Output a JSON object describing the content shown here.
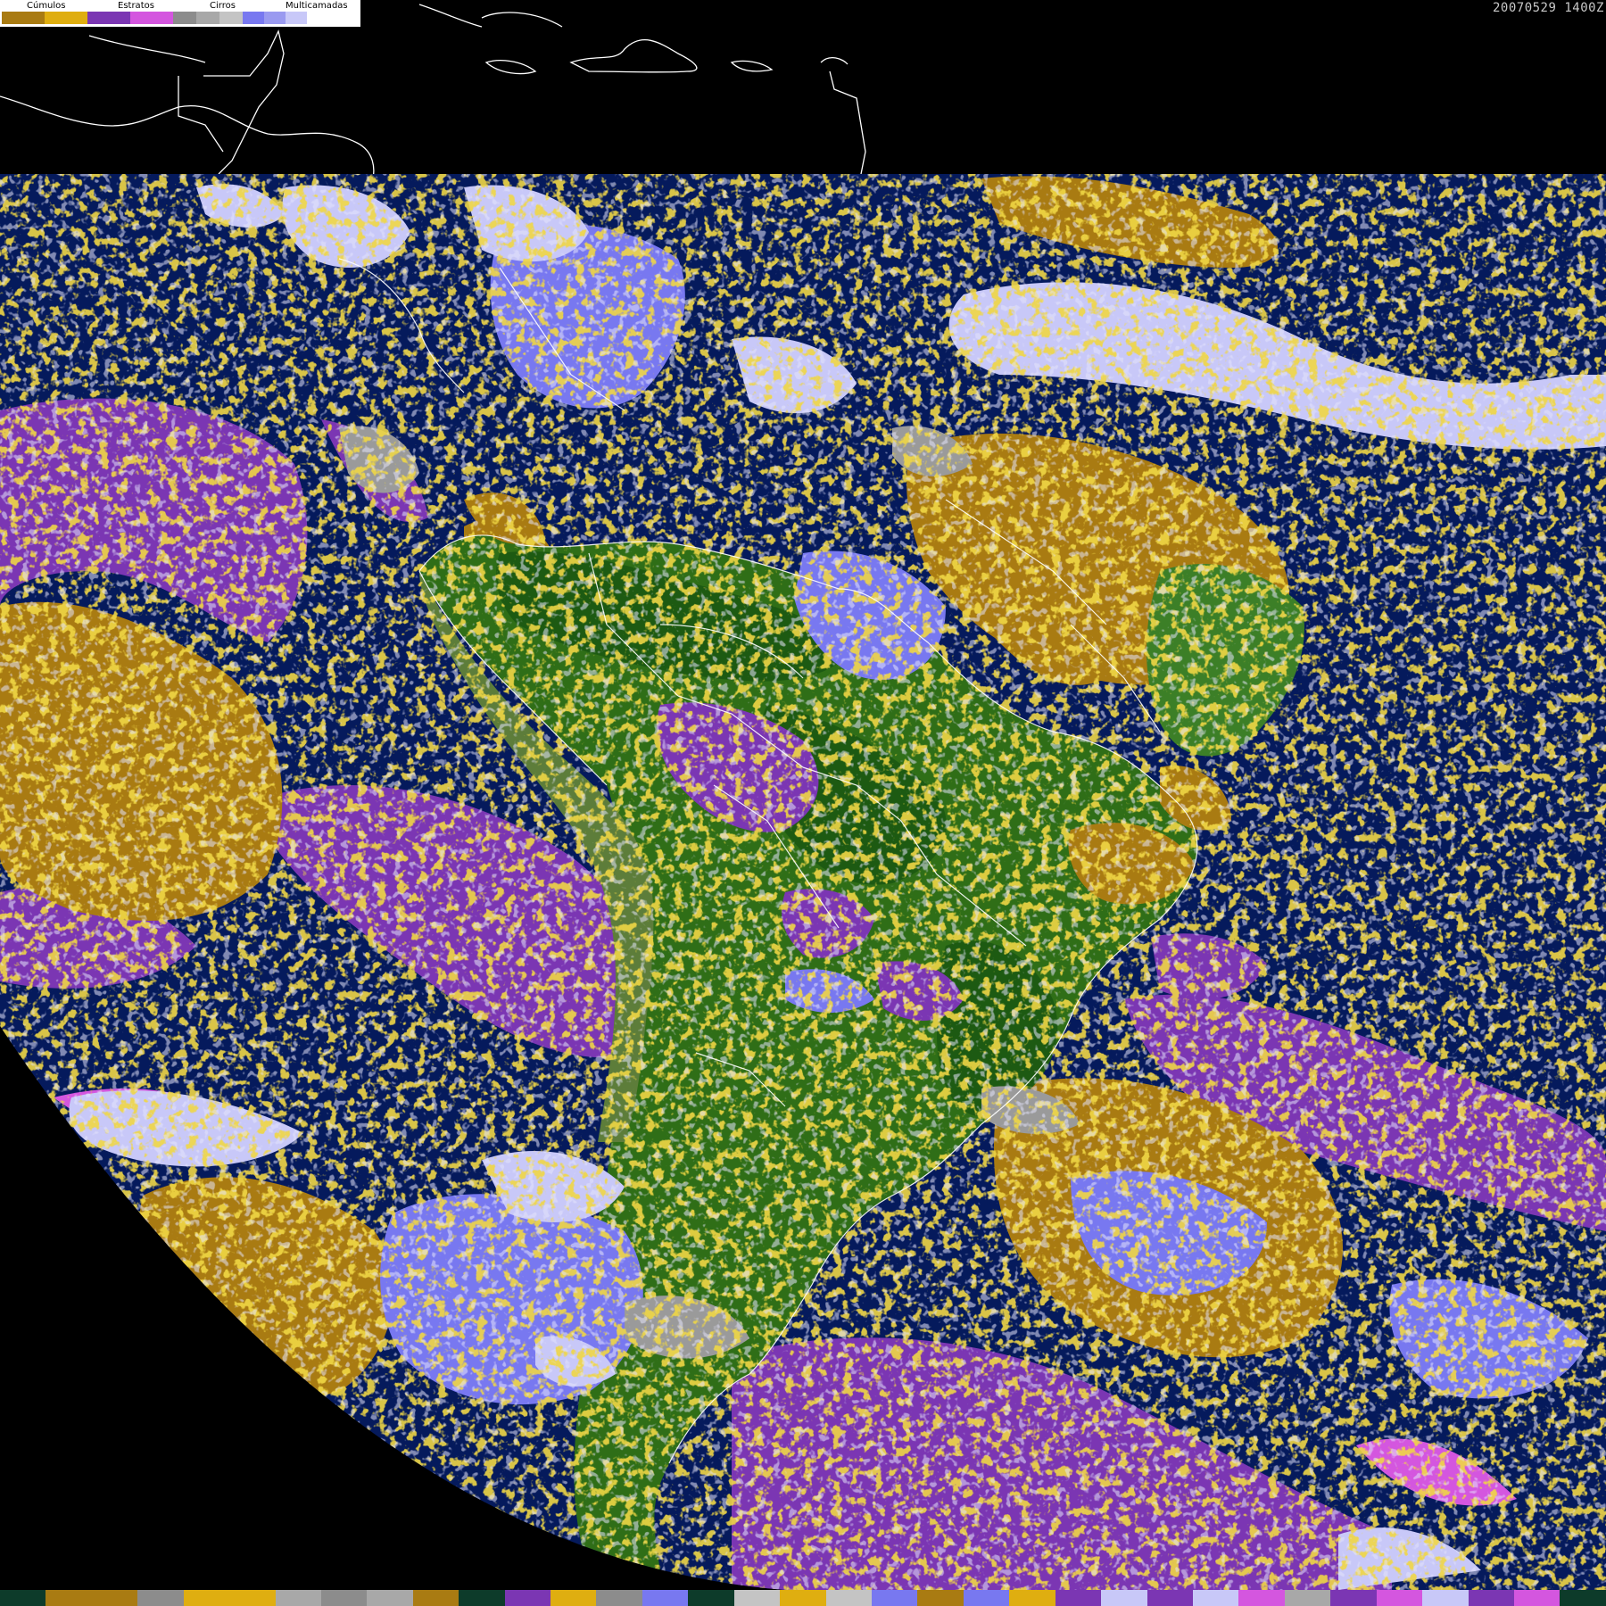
{
  "legend": {
    "groups": [
      {
        "label": "Cúmulos",
        "colors": [
          "#a97b12",
          "#dfae10"
        ]
      },
      {
        "label": "Estratos",
        "colors": [
          "#7b36b3",
          "#d456df"
        ]
      },
      {
        "label": "Cirros",
        "colors": [
          "#8c8c8c",
          "#a8a8a8",
          "#c4c4c4"
        ]
      },
      {
        "label": "Multicamadas",
        "colors": [
          "#7878f0",
          "#9a9af0",
          "#c8c8f8",
          "#ffffff"
        ]
      }
    ]
  },
  "timestamp": "20070529 1400Z",
  "colors": {
    "ocean": "#051a5c",
    "space": "#000000",
    "land_green": "#2f6e17",
    "land_dark": "#1d5a12",
    "cumulus_dark": "#a97b12",
    "cumulus_light": "#dfae10",
    "stratus_dark": "#7b36b3",
    "stratus_light": "#d456df",
    "cirrus_grey": "#9a9a9a",
    "multi_blue": "#7878f0",
    "multi_pale": "#c8c8f8",
    "coastline": "#ffffff"
  },
  "bottom_strip": [
    "#0d3b2a",
    "#a97b12",
    "#a97b12",
    "#8c8c8c",
    "#dfae10",
    "#dfae10",
    "#a8a8a8",
    "#8c8c8c",
    "#a8a8a8",
    "#a97b12",
    "#0d3b2a",
    "#7b36b3",
    "#dfae10",
    "#8c8c8c",
    "#7878f0",
    "#0d3b2a",
    "#c4c4c4",
    "#dfae10",
    "#c4c4c4",
    "#7878f0",
    "#a97b12",
    "#7878f0",
    "#dfae10",
    "#7b36b3",
    "#c8c8f8",
    "#7b36b3",
    "#c8c8f8",
    "#d456df",
    "#a8a8a8",
    "#7b36b3",
    "#d456df",
    "#c8c8f8",
    "#7b36b3",
    "#d456df",
    "#0d3b2a"
  ]
}
